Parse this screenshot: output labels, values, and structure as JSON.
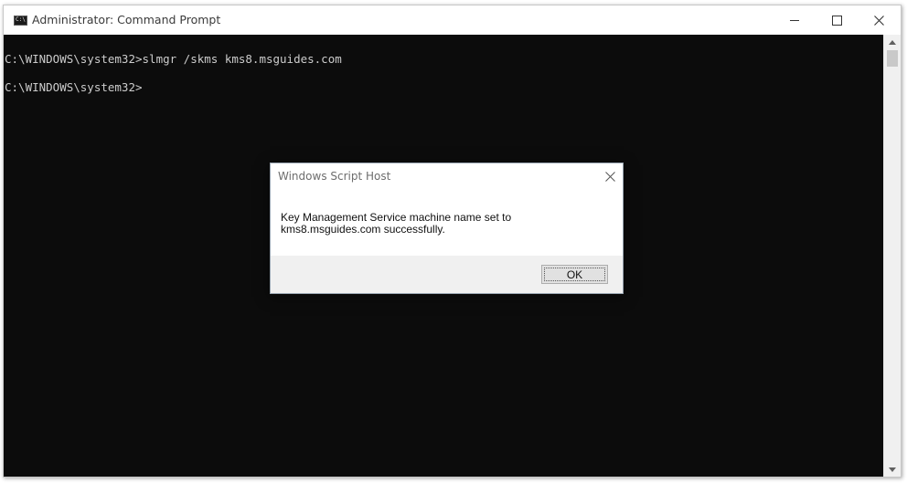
{
  "window": {
    "title": "Administrator: Command Prompt",
    "app_icon_text": "C:\\",
    "icons": [
      "command-prompt-icon",
      "minimize-icon",
      "maximize-icon",
      "close-icon"
    ]
  },
  "console": {
    "lines": [
      "C:\\WINDOWS\\system32>slmgr /skms kms8.msguides.com",
      "C:\\WINDOWS\\system32>"
    ],
    "background": "#0c0c0c",
    "foreground": "#cccccc"
  },
  "dialog": {
    "title": "Windows Script Host",
    "message": "Key Management Service machine name set to kms8.msguides.com successfully.",
    "ok_label": "OK"
  }
}
